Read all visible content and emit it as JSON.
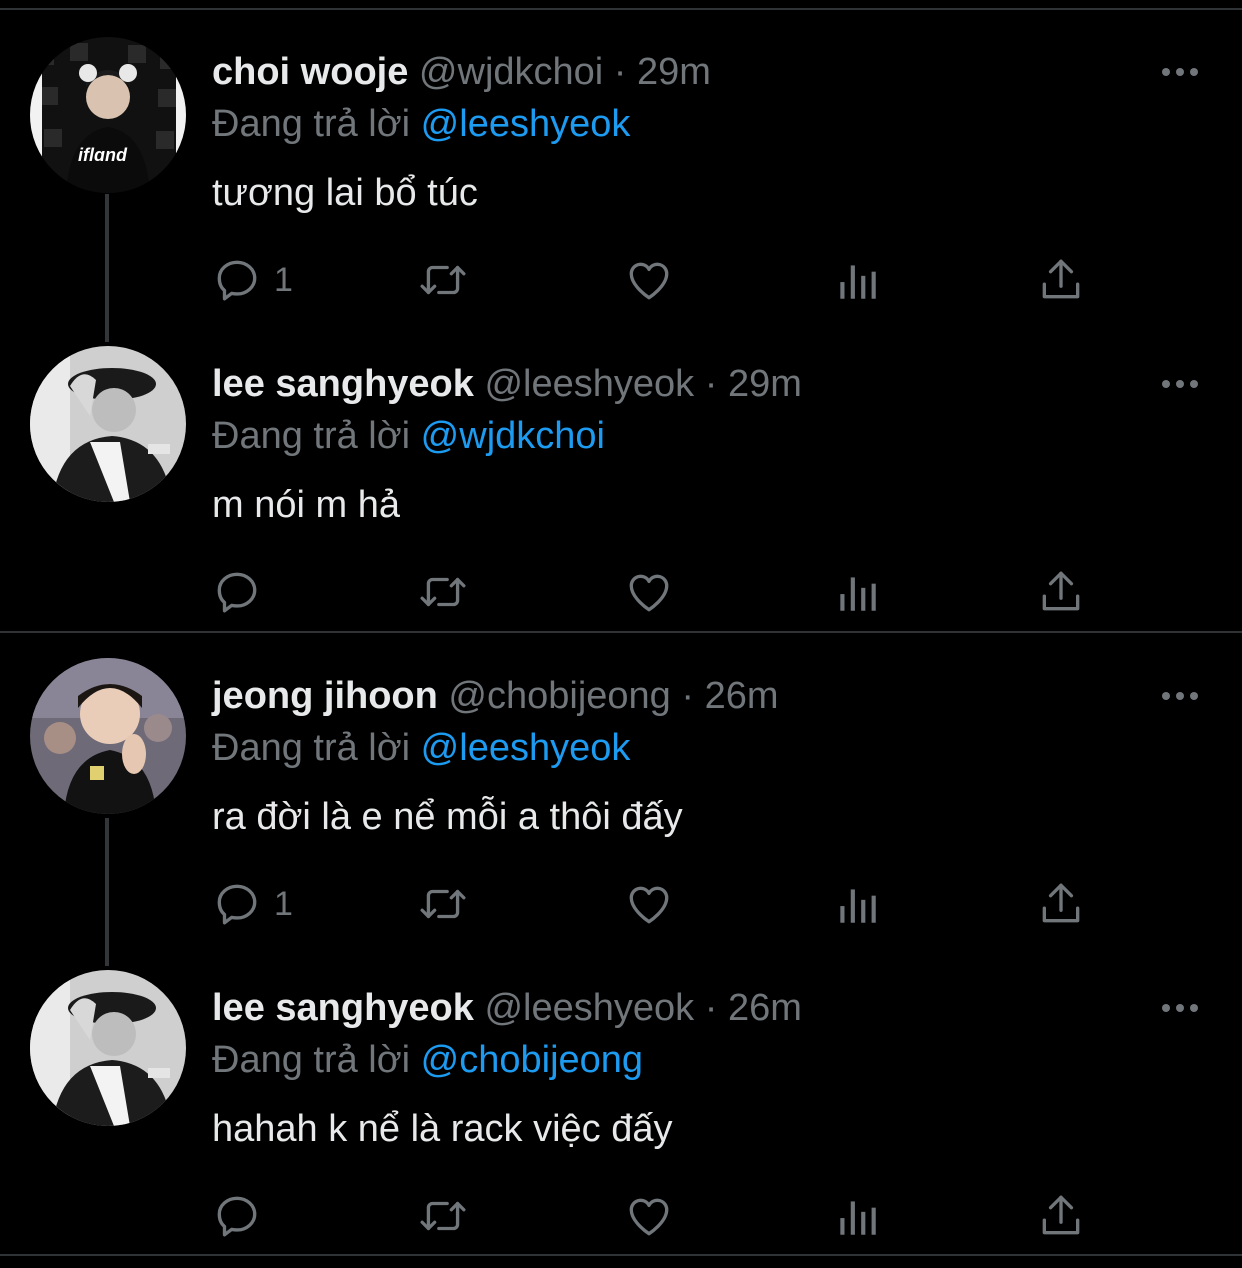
{
  "tweets": [
    {
      "display_name": "choi wooje",
      "handle": "@wjdkchoi",
      "separator": "·",
      "time": "29m",
      "replying_prefix": "Đang trả lời",
      "replying_to": "@leeshyeok",
      "text": "tương lai bổ túc",
      "reply_count": "1",
      "avatar_label": "iflɑnd"
    },
    {
      "display_name": "lee sanghyeok",
      "handle": "@leeshyeok",
      "separator": "·",
      "time": "29m",
      "replying_prefix": "Đang trả lời",
      "replying_to": "@wjdkchoi",
      "text": "m nói m hả",
      "reply_count": ""
    },
    {
      "display_name": "jeong jihoon",
      "handle": "@chobijeong",
      "separator": "·",
      "time": "26m",
      "replying_prefix": "Đang trả lời",
      "replying_to": "@leeshyeok",
      "text": "ra đời là e nể mỗi a thôi đấy",
      "reply_count": "1"
    },
    {
      "display_name": "lee sanghyeok",
      "handle": "@leeshyeok",
      "separator": "·",
      "time": "26m",
      "replying_prefix": "Đang trả lời",
      "replying_to": "@chobijeong",
      "text": "hahah k nể là rack việc đấy",
      "reply_count": ""
    }
  ],
  "icons": {
    "reply": "reply-icon",
    "retweet": "retweet-icon",
    "like": "heart-icon",
    "views": "views-icon",
    "share": "share-icon",
    "more": "more-icon"
  },
  "colors": {
    "background": "#000000",
    "text": "#e7e9ea",
    "secondary": "#71767b",
    "mention": "#1d9bf0",
    "divider": "#2f3336"
  }
}
